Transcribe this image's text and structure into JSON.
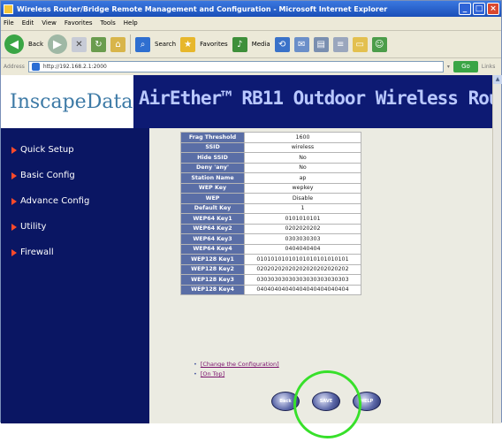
{
  "window": {
    "title": "Wireless Router/Bridge Remote Management and Configuration - Microsoft Internet Explorer"
  },
  "menubar": [
    "File",
    "Edit",
    "View",
    "Favorites",
    "Tools",
    "Help"
  ],
  "toolbar": {
    "back_label": "Back",
    "search_label": "Search",
    "favorites_label": "Favorites",
    "media_label": "Media"
  },
  "address": {
    "label": "Address",
    "url": "http://192.168.2.1:2000",
    "go_label": "Go",
    "links_label": "Links"
  },
  "banner": {
    "logo_part1": "Inscape",
    "logo_part2": "Data",
    "title": "AirEther™ RB11 Outdoor Wireless Router/Bridge"
  },
  "sidebar": {
    "items": [
      {
        "label": "Quick Setup"
      },
      {
        "label": "Basic Config"
      },
      {
        "label": "Advance Config"
      },
      {
        "label": "Utility"
      },
      {
        "label": "Firewall"
      }
    ]
  },
  "config_rows": [
    {
      "label": "Frag Threshold",
      "value": "1600"
    },
    {
      "label": "SSID",
      "value": "wireless"
    },
    {
      "label": "Hide SSID",
      "value": "No"
    },
    {
      "label": "Deny 'any'",
      "value": "No"
    },
    {
      "label": "Station Name",
      "value": "ap"
    },
    {
      "label": "WEP Key",
      "value": "wepkey"
    },
    {
      "label": "WEP",
      "value": "Disable"
    },
    {
      "label": "Default Key",
      "value": "1"
    },
    {
      "label": "WEP64 Key1",
      "value": "0101010101"
    },
    {
      "label": "WEP64 Key2",
      "value": "0202020202"
    },
    {
      "label": "WEP64 Key3",
      "value": "0303030303"
    },
    {
      "label": "WEP64 Key4",
      "value": "0404040404"
    },
    {
      "label": "WEP128 Key1",
      "value": "01010101010101010101010101"
    },
    {
      "label": "WEP128 Key2",
      "value": "02020202020202020202020202"
    },
    {
      "label": "WEP128 Key3",
      "value": "03030303030303030303030303"
    },
    {
      "label": "WEP128 Key4",
      "value": "04040404040404040404040404"
    }
  ],
  "links": {
    "change_config": "[Change the Configuration]",
    "on_top": "[On Top]"
  },
  "buttons": {
    "back": "Back",
    "save": "SAVE",
    "help": "HELP"
  },
  "colors": {
    "sidebar_bg": "#0a1663",
    "banner_bg": "#0d1a73",
    "table_label_bg": "#5a6ea6",
    "highlight_ring": "#37e02a"
  }
}
